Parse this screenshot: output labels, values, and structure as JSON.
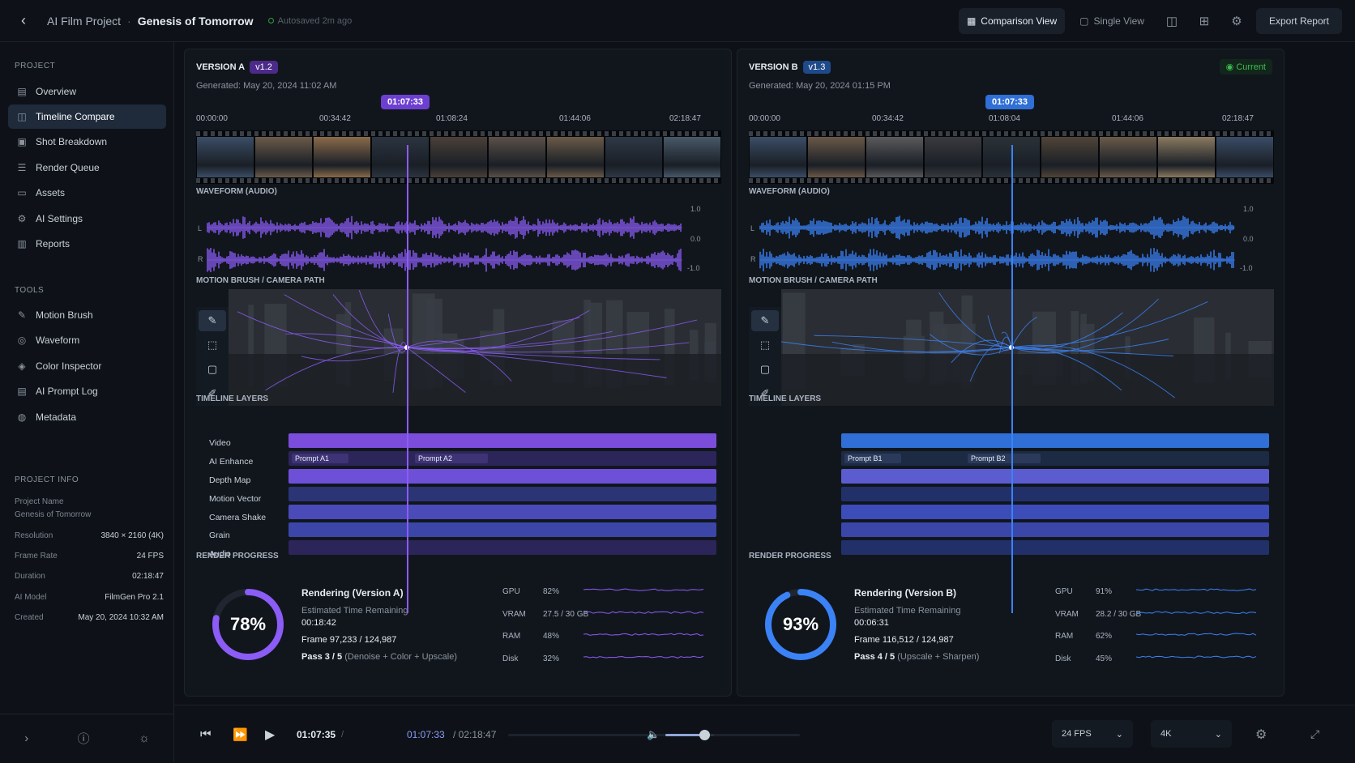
{
  "header": {
    "project": "AI Film Project",
    "separator": "·",
    "title": "Genesis of Tomorrow",
    "autosave": "Autosaved 2m ago",
    "comparison_view": "Comparison View",
    "single_view": "Single View",
    "export": "Export Report"
  },
  "sidebar": {
    "project_title": "PROJECT",
    "project_items": [
      {
        "label": "Overview",
        "icon": "grid-icon"
      },
      {
        "label": "Timeline Compare",
        "icon": "compare-icon",
        "active": true
      },
      {
        "label": "Shot Breakdown",
        "icon": "film-icon"
      },
      {
        "label": "Render Queue",
        "icon": "queue-icon"
      },
      {
        "label": "Assets",
        "icon": "folder-icon"
      },
      {
        "label": "AI Settings",
        "icon": "gear-icon"
      },
      {
        "label": "Reports",
        "icon": "report-icon"
      }
    ],
    "tools_title": "TOOLS",
    "tool_items": [
      {
        "label": "Motion Brush",
        "icon": "brush-icon"
      },
      {
        "label": "Waveform",
        "icon": "waveform-icon"
      },
      {
        "label": "Color Inspector",
        "icon": "color-icon"
      },
      {
        "label": "AI Prompt Log",
        "icon": "log-icon"
      },
      {
        "label": "Metadata",
        "icon": "metadata-icon"
      }
    ],
    "info_title": "PROJECT INFO",
    "project_name_label": "Project Name",
    "project_name": "Genesis of Tomorrow",
    "info": [
      {
        "k": "Resolution",
        "v": "3840 × 2160 (4K)"
      },
      {
        "k": "Frame Rate",
        "v": "24 FPS"
      },
      {
        "k": "Duration",
        "v": "02:18:47"
      },
      {
        "k": "AI Model",
        "v": "FilmGen Pro 2.1"
      },
      {
        "k": "Created",
        "v": "May 20, 2024 10:32 AM"
      }
    ]
  },
  "panels": [
    {
      "title": "VERSION A",
      "version": "v1.2",
      "accent": "#8b5cf6",
      "generated": "Generated: May 20, 2024 11:02 AM",
      "current": "",
      "playhead": "01:07:33",
      "ticks": [
        "00:00:00",
        "00:34:42",
        "01:08:24",
        "01:44:06",
        "02:18:47"
      ],
      "waveform_label": "WAVEFORM (AUDIO)",
      "wave_l": "L",
      "wave_r": "R",
      "wave_scale": [
        "1.0",
        "0.0",
        "-1.0"
      ],
      "motion_label": "MOTION BRUSH / CAMERA PATH",
      "layers_label": "TIMELINE LAYERS",
      "layers": [
        "Video",
        "AI Enhance",
        "Depth Map",
        "Motion Vector",
        "Camera Shake",
        "Grain",
        "Audio"
      ],
      "chips": [
        "Prompt A1",
        "Prompt A2"
      ],
      "render_label": "RENDER PROGRESS",
      "percent": 78,
      "percent_text": "78%",
      "render_title": "Rendering (Version A)",
      "eta_label": "Estimated Time Remaining",
      "eta": "00:18:42",
      "frame": "Frame 97,233 / 124,987",
      "pass": "Pass 3 / 5",
      "pass_detail": "(Denoise + Color + Upscale)",
      "stats": [
        {
          "name": "GPU",
          "pct": "82%"
        },
        {
          "name": "VRAM",
          "pct": "27.5 / 30 GB"
        },
        {
          "name": "RAM",
          "pct": "48%"
        },
        {
          "name": "Disk",
          "pct": "32%"
        }
      ]
    },
    {
      "title": "VERSION B",
      "version": "v1.3",
      "accent": "#3b82f6",
      "generated": "Generated: May 20, 2024 01:15 PM",
      "current": "Current",
      "playhead": "01:07:33",
      "ticks": [
        "00:00:00",
        "00:34:42",
        "01:08:04",
        "01:44:06",
        "02:18:47"
      ],
      "waveform_label": "WAVEFORM (AUDIO)",
      "wave_l": "L",
      "wave_r": "R",
      "wave_scale": [
        "1.0",
        "0.0",
        "-1.0"
      ],
      "motion_label": "MOTION BRUSH / CAMERA PATH",
      "layers_label": "TIMELINE LAYERS",
      "layers": [
        "",
        "",
        "",
        "",
        "",
        "",
        ""
      ],
      "chips": [
        "Prompt B1",
        "Prompt B2"
      ],
      "render_label": "RENDER PROGRESS",
      "percent": 93,
      "percent_text": "93%",
      "render_title": "Rendering (Version B)",
      "eta_label": "Estimated Time Remaining",
      "eta": "00:06:31",
      "frame": "Frame 116,512 / 124,987",
      "pass": "Pass 4 / 5",
      "pass_detail": "(Upscale + Sharpen)",
      "stats": [
        {
          "name": "GPU",
          "pct": "91%"
        },
        {
          "name": "VRAM",
          "pct": "28.2 / 30 GB"
        },
        {
          "name": "RAM",
          "pct": "62%"
        },
        {
          "name": "Disk",
          "pct": "45%"
        }
      ]
    }
  ],
  "playback": {
    "current": "01:07:35",
    "sep": "/",
    "center_time": "01:07:33",
    "total": "/ 02:18:47",
    "volume": 0.8,
    "fps": "24 FPS",
    "quality": "4K"
  }
}
